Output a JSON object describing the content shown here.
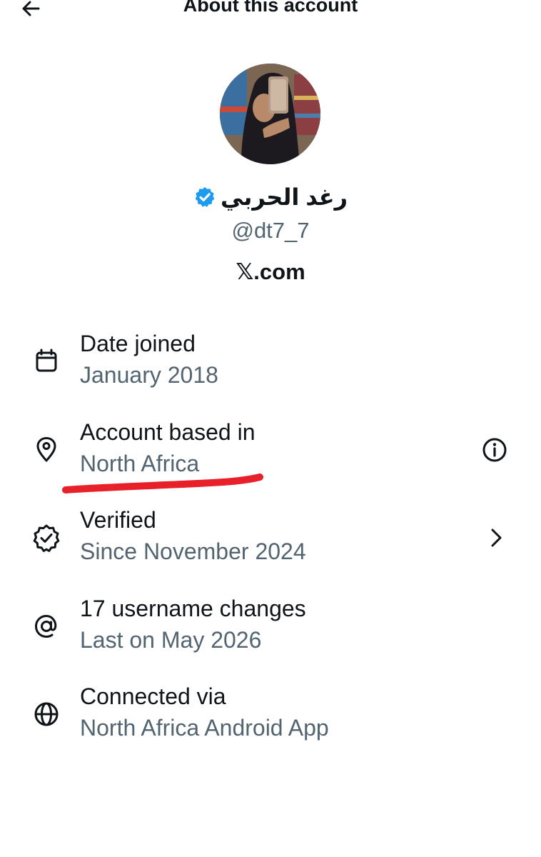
{
  "header": {
    "title": "About this account"
  },
  "profile": {
    "display_name": "رغد الحربي",
    "handle": "@dt7_7",
    "site": "𝕏.com"
  },
  "rows": [
    {
      "label": "Date joined",
      "value": "January 2018",
      "icon": "calendar-icon"
    },
    {
      "label": "Account based in",
      "value": "North Africa",
      "icon": "location-pin-icon",
      "action_icon": "info-icon"
    },
    {
      "label": "Verified",
      "value": "Since November 2024",
      "icon": "verified-badge-outline-icon",
      "action_icon": "chevron-right-icon"
    },
    {
      "label": "17 username changes",
      "value": "Last on May 2026",
      "icon": "at-sign-icon"
    },
    {
      "label": "Connected via",
      "value": "North Africa Android App",
      "icon": "globe-icon"
    }
  ],
  "colors": {
    "text_primary": "#0f1419",
    "text_secondary": "#536471",
    "verified_blue": "#1d9bf0",
    "annotation_red": "#e8202a"
  }
}
